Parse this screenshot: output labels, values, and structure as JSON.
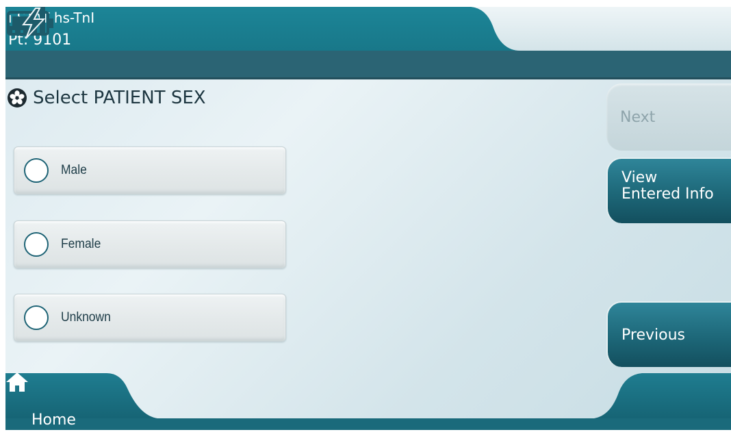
{
  "header": {
    "device_name": "i-STAT hs-TnI",
    "patient_id": "Pt: 9101",
    "signal_icon": "signal-bars-icon",
    "battery_icon": "battery-charging-icon"
  },
  "prompt": {
    "icon": "asterisk-required-icon",
    "text": "Select PATIENT SEX"
  },
  "options": [
    {
      "label": "Male",
      "selected": false
    },
    {
      "label": "Female",
      "selected": false
    },
    {
      "label": "Unknown",
      "selected": false
    }
  ],
  "buttons": {
    "next": {
      "label": "Next",
      "enabled": false
    },
    "view_entered_info": {
      "line1": "View",
      "line2": "Entered Info"
    },
    "previous": {
      "label": "Previous",
      "enabled": true
    }
  },
  "footer": {
    "home_label": "Home",
    "home_icon": "home-icon"
  },
  "colors": {
    "header_teal": "#1e7384",
    "header_dark": "#2b6575",
    "button_teal": "#1d6778",
    "background": "#dbe9ef"
  }
}
